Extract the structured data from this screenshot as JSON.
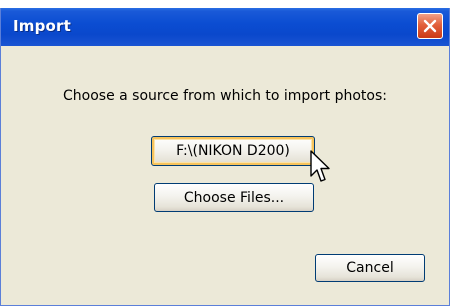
{
  "window": {
    "title": "Import"
  },
  "titlebar": {
    "close_icon": "close-icon"
  },
  "dialog": {
    "prompt": "Choose a source from which to import photos:"
  },
  "buttons": {
    "source": "F:\\(NIKON D200)",
    "choose_files": "Choose Files...",
    "cancel": "Cancel"
  },
  "pointer": {
    "icon": "mouse-pointer-icon"
  },
  "colors": {
    "titlebar": "#0b4dd2",
    "dialog_background": "#ece9d8",
    "close_button": "#e2603c",
    "focus_ring": "#f7c35c"
  }
}
